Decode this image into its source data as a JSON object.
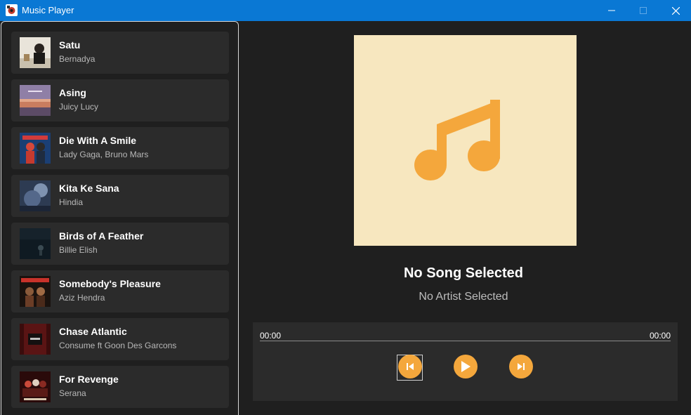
{
  "window": {
    "title": "Music Player",
    "accent": "#0a78d4"
  },
  "songs": [
    {
      "title": "Satu",
      "artist": "Bernadya"
    },
    {
      "title": "Asing",
      "artist": "Juicy Lucy"
    },
    {
      "title": "Die With A Smile",
      "artist": "Lady Gaga, Bruno Mars"
    },
    {
      "title": "Kita Ke Sana",
      "artist": "Hindia"
    },
    {
      "title": "Birds of A Feather",
      "artist": "Billie Elish"
    },
    {
      "title": "Somebody's Pleasure",
      "artist": "Aziz Hendra"
    },
    {
      "title": "Chase Atlantic",
      "artist": "Consume ft Goon Des Garcons"
    },
    {
      "title": "For Revenge",
      "artist": "Serana"
    }
  ],
  "now_playing": {
    "title": "No Song Selected",
    "artist": "No Artist Selected",
    "cover_icon": "music-note-icon",
    "cover_bg": "#f7e7bf",
    "icon_color": "#f4a73c"
  },
  "player": {
    "current_time": "00:00",
    "total_time": "00:00",
    "progress": 0,
    "controls": [
      "previous-icon",
      "play-icon",
      "next-icon"
    ]
  }
}
